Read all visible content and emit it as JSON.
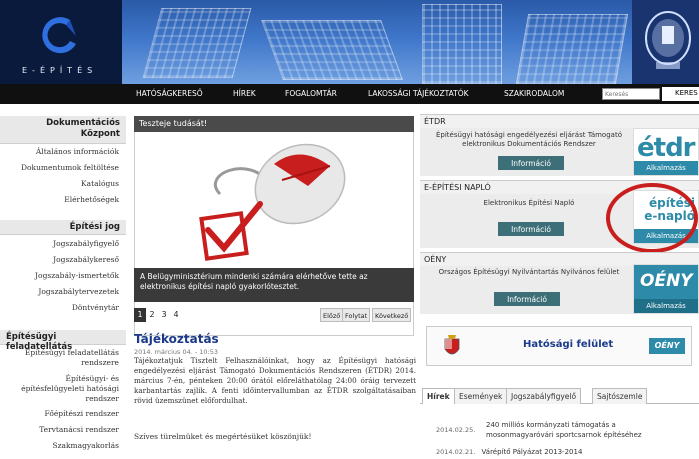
{
  "header": {
    "logo_text": "E-ÉPÍTÉS",
    "nav": [
      "HATÓSÁGKERESŐ",
      "HÍREK",
      "FOGALOMTÁR",
      "LAKOSSÁGI TÁJÉKOZTATÓK",
      "SZAKIRODALOM"
    ],
    "search_placeholder": "Keresés",
    "search_button": "KERES"
  },
  "sidebar": {
    "sections": [
      {
        "title_lines": [
          "Dokumentációs",
          "Központ"
        ],
        "items": [
          "Általános információk",
          "Dokumentumok feltöltése",
          "Katalógus",
          "Elérhetőségek"
        ]
      },
      {
        "title_lines": [
          "Építési jog"
        ],
        "items": [
          "Jogszabályfigyelő",
          "Jogszabálykereső",
          "Jogszabály-ismertetők",
          "Jogszabálytervezetek",
          "Döntvénytár"
        ]
      },
      {
        "title_lines": [
          "Építésügyi feladatellátás"
        ],
        "items": [
          "Építésügyi feladatellátás rendszere",
          "Építésügyi- és építésfelügyeleti hatósági rendszer",
          "Főépítészi rendszer",
          "Tervtanácsi rendszer",
          "Szakmagyakorlás"
        ]
      }
    ]
  },
  "slider": {
    "title": "Teszteje tudását!",
    "caption": "A Belügyminisztérium mindenki számára elérhetőve tette az elektronikus építési napló gyakorlótesztet.",
    "pages": [
      "1",
      "2",
      "3",
      "4"
    ],
    "controls": [
      "Előző",
      "Folytat",
      "Következő"
    ]
  },
  "news": {
    "title": "Tájékoztatás",
    "date": "2014. március 04. - 10:53",
    "body": "Tájékoztatjuk Tisztelt Felhasználóinkat, hogy az Építésügyi hatósági engedélyezési eljárást Támogató Dokumentációs Rendszeren (ÉTDR) 2014. március 7-én, pénteken 20:00 órától előreláthatólag 24:00 óráig tervezett karbantartás zajlik. A fenti időintervallumban az ÉTDR szolgáltatásaiban rövid üzemszünet előfordulhat.",
    "thanks": "Szíves türelmüket és megértésüket köszönjük!"
  },
  "right": {
    "etdr": {
      "head": "ÉTDR",
      "text": "Építésügyi hatósági engedélyezési eljárást Támogató elektronikus Dokumentációs Rendszer",
      "button": "Információ",
      "logo": "étdr",
      "app": "Alkalmazás"
    },
    "naplo": {
      "head": "E-ÉPÍTÉSI NAPLÓ",
      "text": "Elektronikus Építési Napló",
      "button": "Információ",
      "logo_lines": [
        "építési",
        "e-napló"
      ],
      "app": "Alkalmazás"
    },
    "oeny": {
      "head": "OÉNY",
      "text": "Országos Építésügyi Nyilvántartás Nyilvános felület",
      "button": "Információ",
      "logo": "OÉNY",
      "app": "Alkalmazás"
    },
    "hatosagi": {
      "label": "Hatósági felület",
      "badge": "OÉNY"
    },
    "tabs": [
      "Hírek",
      "Események",
      "Jogszabályfigyelő",
      "Sajtószemle"
    ],
    "news_list": [
      {
        "date": "2014.02.25.",
        "text_lines": [
          "240 milliós kormányzati támogatás a",
          "mosonmagyaróvári sportcsarnok építéséhez"
        ]
      },
      {
        "date": "2014.02.21.",
        "text_lines": [
          "Várépítő Pályázat 2013-2014"
        ]
      }
    ]
  },
  "colors": {
    "accent": "#c81e1e",
    "nav_bg": "#101010",
    "header_bg": "#0c1f4a",
    "teal": "#3d6f78",
    "title_blue": "#1a3a8a"
  }
}
